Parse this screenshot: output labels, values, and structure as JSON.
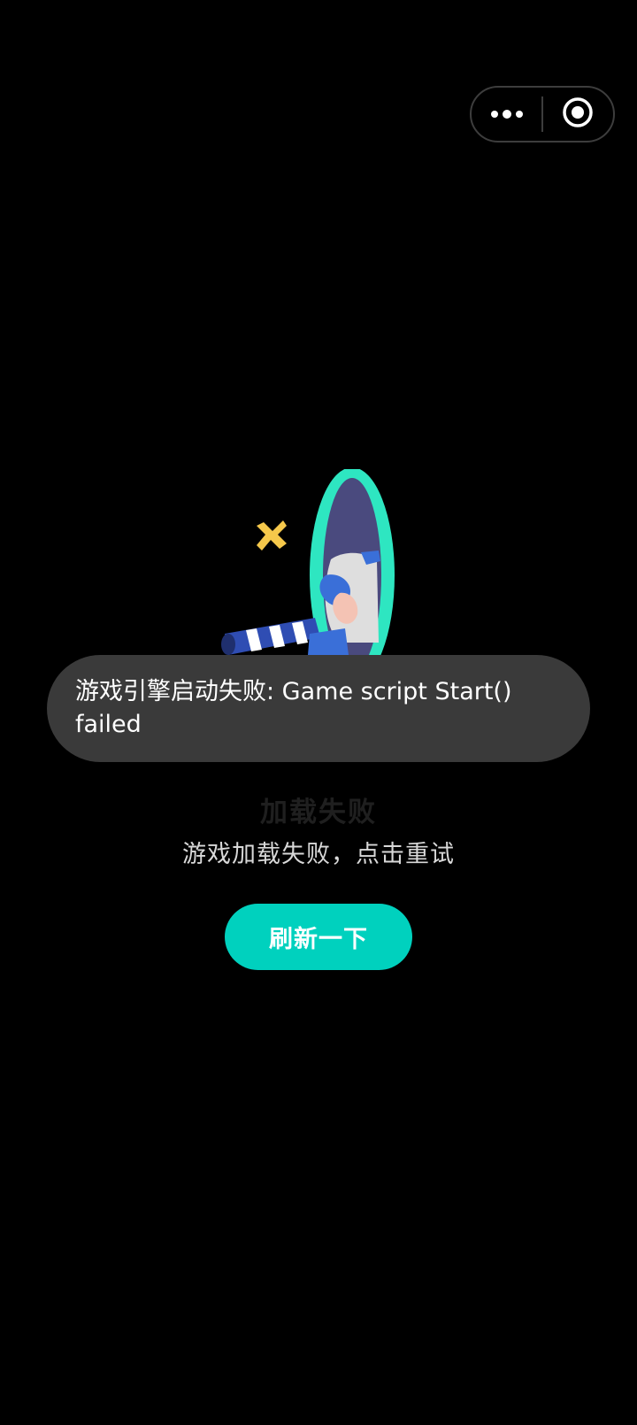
{
  "capsule": {
    "more_icon": "more-dots-icon",
    "close_icon": "target-circle-icon"
  },
  "toast": {
    "message": "游戏引擎启动失败: Game script Start() failed"
  },
  "error": {
    "title": "加载失败",
    "subtitle": "游戏加载失败，点击重试"
  },
  "refresh_button": {
    "label": "刷新一下"
  },
  "colors": {
    "background": "#000000",
    "accent": "#00d1be",
    "toast_background": "#3a3a3a",
    "portal_ring": "#2ee6c1",
    "portal_inner": "#4a4a7e",
    "star": "#f5c84b"
  }
}
